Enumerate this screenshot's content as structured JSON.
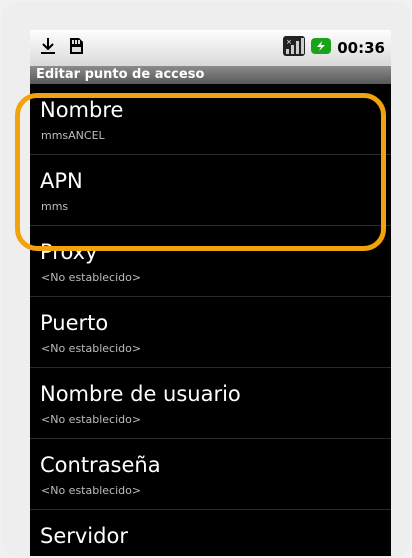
{
  "status_bar": {
    "time": "00:36",
    "icons": [
      "download-icon",
      "sd-card-icon",
      "signal-icon",
      "battery-charging-icon"
    ],
    "colors": {
      "battery": "#1aa31a"
    }
  },
  "title_bar": {
    "title": "Editar punto de acceso"
  },
  "settings": [
    {
      "label": "Nombre",
      "value": "mmsANCEL"
    },
    {
      "label": "APN",
      "value": "mms"
    },
    {
      "label": "Proxy",
      "value": "<No establecido>"
    },
    {
      "label": "Puerto",
      "value": "<No establecido>"
    },
    {
      "label": "Nombre de usuario",
      "value": "<No establecido>"
    },
    {
      "label": "Contraseña",
      "value": "<No establecido>"
    },
    {
      "label": "Servidor",
      "value": ""
    }
  ],
  "highlight": {
    "color": "#f2a20b"
  }
}
